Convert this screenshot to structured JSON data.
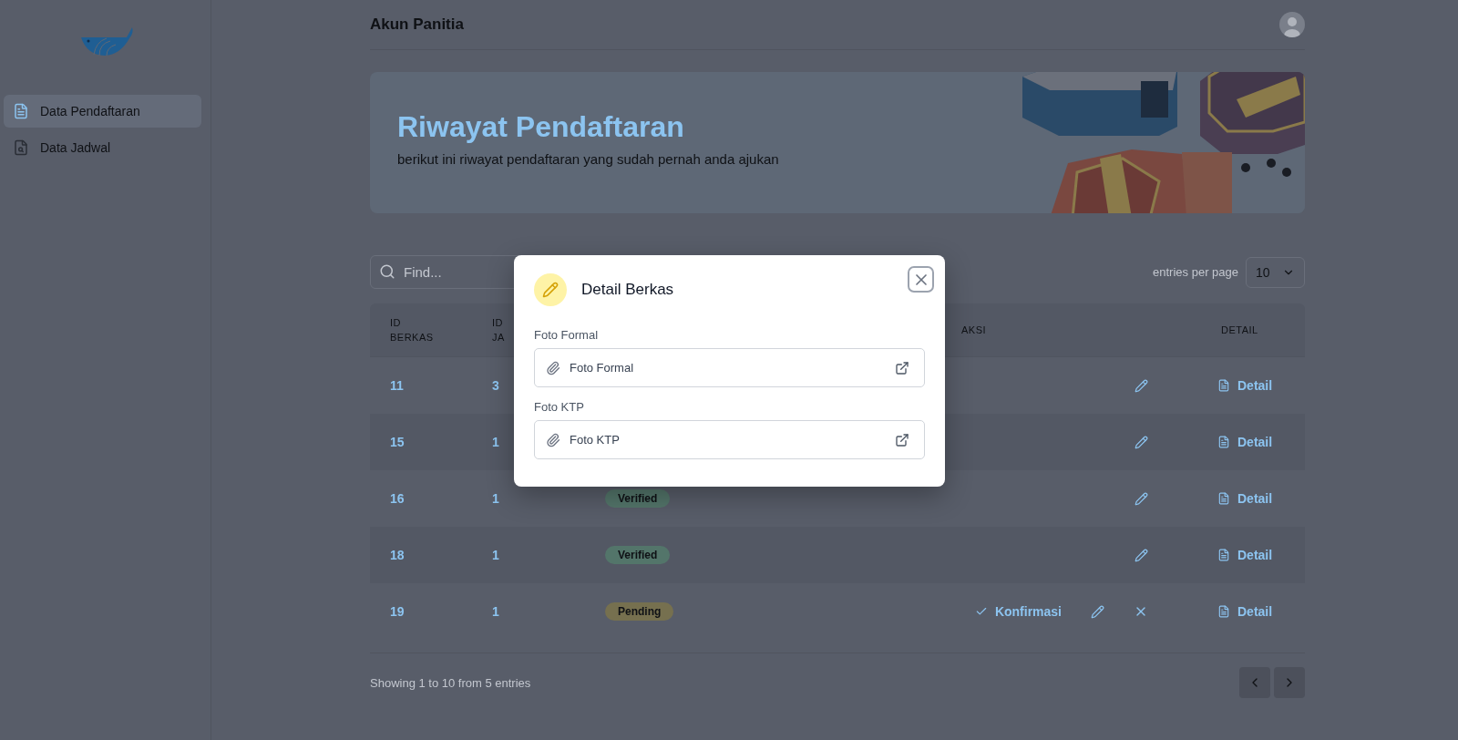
{
  "sidebar": {
    "items": [
      {
        "label": "Data Pendaftaran",
        "selected": true
      },
      {
        "label": "Data Jadwal",
        "selected": false
      }
    ]
  },
  "header": {
    "title": "Akun Panitia"
  },
  "banner": {
    "title": "Riwayat Pendaftaran",
    "subtitle": "berikut ini riwayat pendaftaran yang sudah pernah anda ajukan",
    "kind": "picture"
  },
  "search": {
    "placeholder": "Find..."
  },
  "entries": {
    "label": "entries per page",
    "value": "10"
  },
  "table": {
    "columns": [
      "ID BERKAS",
      "ID JA",
      "",
      "AKSI",
      "DETAIL"
    ],
    "rows": [
      {
        "id": "11",
        "id_jadwal": "3",
        "actions": [
          {
            "kind": "edit"
          }
        ],
        "detail": "Detail"
      },
      {
        "id": "15",
        "id_jadwal": "1",
        "actions": [
          {
            "kind": "edit"
          }
        ],
        "detail": "Detail"
      },
      {
        "id": "16",
        "id_jadwal": "1",
        "status": {
          "label": "Verified",
          "kind": "verified"
        },
        "actions": [
          {
            "kind": "edit"
          }
        ],
        "detail": "Detail"
      },
      {
        "id": "18",
        "id_jadwal": "1",
        "status": {
          "label": "Verified",
          "kind": "verified"
        },
        "actions": [
          {
            "kind": "edit"
          }
        ],
        "detail": "Detail"
      },
      {
        "id": "19",
        "id_jadwal": "1",
        "status": {
          "label": "Pending",
          "kind": "pending"
        },
        "actions": [
          {
            "kind": "confirm",
            "label": "Konfirmasi"
          },
          {
            "kind": "edit"
          },
          {
            "kind": "reject"
          }
        ],
        "detail": "Detail"
      }
    ]
  },
  "footer": {
    "summary": "Showing 1 to 10 from 5 entries"
  },
  "modal": {
    "title": "Detail Berkas",
    "fields": [
      {
        "label": "Foto Formal",
        "value": "Foto Formal"
      },
      {
        "label": "Foto KTP",
        "value": "Foto KTP"
      }
    ]
  }
}
